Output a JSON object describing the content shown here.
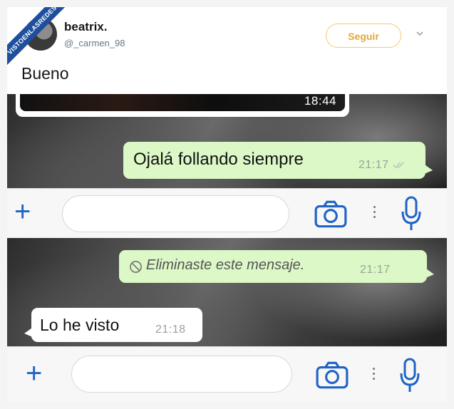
{
  "watermark": "VISTOENLASREDES",
  "tweet": {
    "display_name": "beatrix.",
    "handle": "@_carmen_98",
    "follow_label": "Seguir",
    "text": "Bueno"
  },
  "chat1": {
    "image_time": "18:44",
    "outgoing": {
      "text": "Ojalá follando siempre",
      "time": "21:17"
    }
  },
  "chat2": {
    "deleted": {
      "text": "Eliminaste este mensaje.",
      "time": "21:17"
    },
    "incoming": {
      "text": "Lo he visto",
      "time": "21:18"
    }
  },
  "input_bar": {
    "icons": [
      "plus-icon",
      "camera-icon",
      "more-dots-icon",
      "microphone-icon"
    ]
  },
  "colors": {
    "accent_blue": "#1f63c6",
    "bubble_out": "#dcf8c6",
    "bubble_in": "#ffffff",
    "follow": "#e0a93a"
  }
}
